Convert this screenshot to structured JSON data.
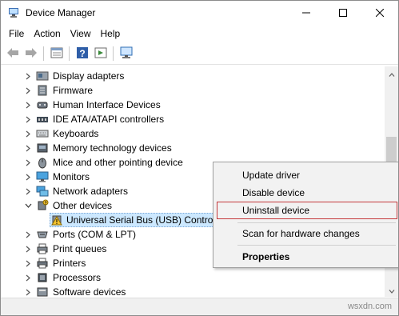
{
  "window": {
    "title": "Device Manager",
    "icon": "device-manager-icon",
    "controls": [
      "minimize-icon",
      "maximize-icon",
      "close-icon"
    ]
  },
  "menubar": {
    "items": [
      "File",
      "Action",
      "View",
      "Help"
    ]
  },
  "toolbar": {
    "buttons": [
      "back-arrow-icon",
      "forward-arrow-icon",
      "properties-icon",
      "help-icon",
      "show-hidden-icon",
      "monitor-icon"
    ]
  },
  "tree": {
    "items": [
      {
        "label": "Display adapters",
        "icon": "display-adapter-icon",
        "expanded": false
      },
      {
        "label": "Firmware",
        "icon": "firmware-icon",
        "expanded": false
      },
      {
        "label": "Human Interface Devices",
        "icon": "hid-icon",
        "expanded": false
      },
      {
        "label": "IDE ATA/ATAPI controllers",
        "icon": "ide-controller-icon",
        "expanded": false
      },
      {
        "label": "Keyboards",
        "icon": "keyboard-icon",
        "expanded": false
      },
      {
        "label": "Memory technology devices",
        "icon": "memory-icon",
        "expanded": false
      },
      {
        "label": "Mice and other pointing device",
        "icon": "mouse-icon",
        "expanded": false
      },
      {
        "label": "Monitors",
        "icon": "monitor-icon",
        "expanded": false
      },
      {
        "label": "Network adapters",
        "icon": "network-adapter-icon",
        "expanded": false
      },
      {
        "label": "Other devices",
        "icon": "other-devices-icon",
        "expanded": true
      },
      {
        "label": "Universal Serial Bus (USB) Controlle",
        "icon": "warning-device-icon",
        "child": true,
        "selected": true
      },
      {
        "label": "Ports (COM & LPT)",
        "icon": "ports-icon",
        "expanded": false
      },
      {
        "label": "Print queues",
        "icon": "print-queue-icon",
        "expanded": false
      },
      {
        "label": "Printers",
        "icon": "printer-icon",
        "expanded": false
      },
      {
        "label": "Processors",
        "icon": "processor-icon",
        "expanded": false
      },
      {
        "label": "Software devices",
        "icon": "software-device-icon",
        "expanded": false
      }
    ]
  },
  "context_menu": {
    "items": [
      {
        "label": "Update driver"
      },
      {
        "label": "Disable device"
      },
      {
        "label": "Uninstall device",
        "highlighted": true
      },
      {
        "label": "Scan for hardware changes"
      },
      {
        "label": "Properties",
        "bold": true
      }
    ],
    "highlight_color": "#c4383b"
  },
  "watermark": "wsxdn.com",
  "colors": {
    "selection": "#cce8ff",
    "menu_bg": "#f2f2f2"
  }
}
